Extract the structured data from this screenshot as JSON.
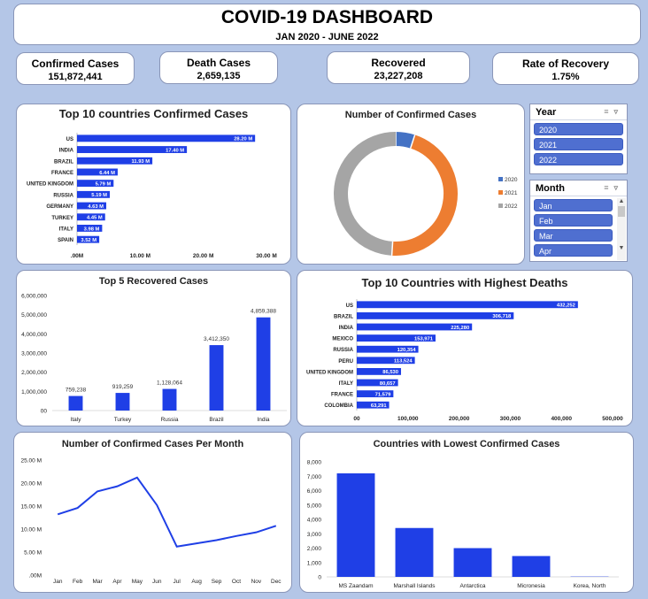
{
  "header": {
    "title": "COVID-19 DASHBOARD",
    "subtitle": "JAN 2020 - JUNE 2022"
  },
  "kpis": [
    {
      "label": "Confirmed Cases",
      "value": "151,872,441"
    },
    {
      "label": "Death Cases",
      "value": "2,659,135"
    },
    {
      "label": "Recovered",
      "value": "23,227,208"
    },
    {
      "label": "Rate of Recovery",
      "value": "1.75%"
    }
  ],
  "slicers": {
    "year": {
      "title": "Year",
      "items": [
        "2020",
        "2021",
        "2022"
      ]
    },
    "month": {
      "title": "Month",
      "items": [
        "Jan",
        "Feb",
        "Mar",
        "Apr"
      ]
    }
  },
  "colors": {
    "bar": "#1f3fe6",
    "line": "#1f3fe6",
    "donut_2020": "#4472c4",
    "donut_2021": "#ed7d31",
    "donut_2022": "#a5a5a5"
  },
  "chart_data": [
    {
      "id": "confirmed",
      "type": "bar",
      "orientation": "horizontal",
      "title": "Top 10 countries Confirmed Cases",
      "categories": [
        "US",
        "INDIA",
        "BRAZIL",
        "FRANCE",
        "UNITED KINGDOM",
        "RUSSIA",
        "GERMANY",
        "TURKEY",
        "ITALY",
        "SPAIN"
      ],
      "values": [
        28.2,
        17.4,
        11.93,
        6.44,
        5.79,
        5.19,
        4.63,
        4.45,
        3.98,
        3.52
      ],
      "labels": [
        "28.20 M",
        "17.40 M",
        "11.93 M",
        "6.44 M",
        "5.79 M",
        "5.19 M",
        "4.63 M",
        "4.45 M",
        "3.98 M",
        "3.52 M"
      ],
      "ticks": [
        ".00M",
        "10.00 M",
        "20.00 M",
        "30.00 M"
      ],
      "xlim": [
        0,
        30
      ]
    },
    {
      "id": "donut",
      "type": "pie",
      "title": "Number of Confirmed Cases",
      "legend": [
        "2020",
        "2021",
        "2022"
      ],
      "values": [
        5,
        46,
        49
      ],
      "legend_position": "right"
    },
    {
      "id": "recovered",
      "type": "bar",
      "title": "Top 5 Recovered Cases",
      "categories": [
        "Italy",
        "Turkey",
        "Russia",
        "Brazil",
        "India"
      ],
      "values": [
        759238,
        919259,
        1128064,
        3412350,
        4859388
      ],
      "labels": [
        "759,238",
        "919,259",
        "1,128,064",
        "3,412,350",
        "4,859,388"
      ],
      "ticks": [
        "00",
        "1,000,000",
        "2,000,000",
        "3,000,000",
        "4,000,000",
        "5,000,000",
        "6,000,000"
      ],
      "ylim": [
        0,
        6000000
      ]
    },
    {
      "id": "deaths",
      "type": "bar",
      "orientation": "horizontal",
      "title": "Top 10 Countries with Highest Deaths",
      "categories": [
        "US",
        "BRAZIL",
        "INDIA",
        "MEXICO",
        "RUSSIA",
        "PERU",
        "UNITED KINGDOM",
        "ITALY",
        "FRANCE",
        "COLOMBIA"
      ],
      "values": [
        432252,
        306718,
        225280,
        153971,
        120354,
        113524,
        86530,
        80657,
        71579,
        63291
      ],
      "labels": [
        "432,252",
        "306,718",
        "225,280",
        "153,971",
        "120,354",
        "113,524",
        "86,530",
        "80,657",
        "71,579",
        "63,291"
      ],
      "ticks": [
        "00",
        "100,000",
        "200,000",
        "300,000",
        "400,000",
        "500,000"
      ],
      "xlim": [
        0,
        500000
      ]
    },
    {
      "id": "monthly",
      "type": "line",
      "title": "Number of Confirmed Cases Per Month",
      "categories": [
        "Jan",
        "Feb",
        "Mar",
        "Apr",
        "May",
        "Jun",
        "Jul",
        "Aug",
        "Sep",
        "Oct",
        "Nov",
        "Dec"
      ],
      "values": [
        13.2,
        14.6,
        18.2,
        19.3,
        21.2,
        15.2,
        6.2,
        6.9,
        7.6,
        8.5,
        9.3,
        10.7
      ],
      "ticks": [
        ".00M",
        "5.00 M",
        "10.00 M",
        "15.00 M",
        "20.00 M",
        "25.00 M"
      ],
      "ylim": [
        0,
        25
      ]
    },
    {
      "id": "lowest",
      "type": "bar",
      "title": "Countries with Lowest Confirmed Cases",
      "categories": [
        "MS Zaandam",
        "Marshall Islands",
        "Antarctica",
        "Micronesia",
        "Korea, North"
      ],
      "values": [
        7200,
        3400,
        2000,
        1450,
        20
      ],
      "ticks": [
        "0",
        "1,000",
        "2,000",
        "3,000",
        "4,000",
        "5,000",
        "6,000",
        "7,000",
        "8,000"
      ],
      "ylim": [
        0,
        8000
      ]
    }
  ]
}
